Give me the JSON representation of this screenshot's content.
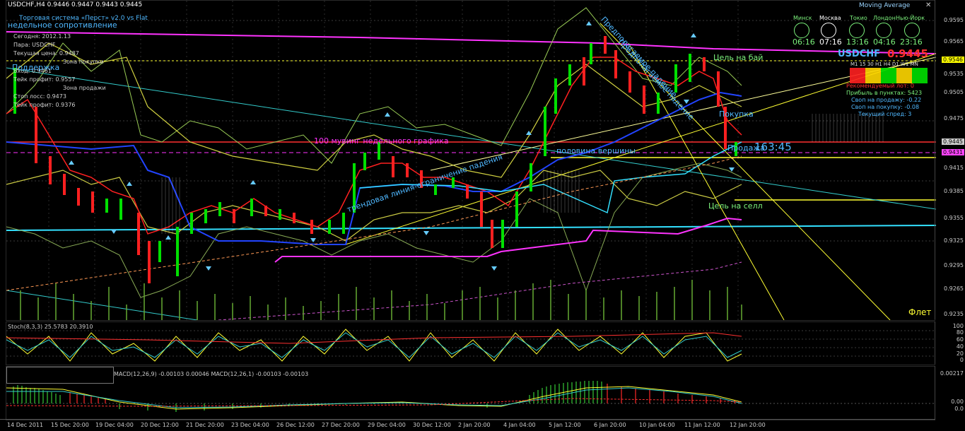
{
  "header": {
    "symbol_line": "USDCHF,H4  0.9446 0.9447 0.9443 0.9445",
    "indicator_name": "Moving Average",
    "subtitle": "Торговая система «Перст» v2.0 vs Flat"
  },
  "clocks": [
    {
      "city": "Минск",
      "time": "06:16"
    },
    {
      "city": "Москва",
      "time": "07:16"
    },
    {
      "city": "Токио",
      "time": "13:16"
    },
    {
      "city": "Лондон",
      "time": "04:16"
    },
    {
      "city": "Нью-Йорк",
      "time": "23:16"
    }
  ],
  "info_left": [
    "Сегодня: 2012.1.13",
    "Пара:  USDCHF",
    "Текущая цена: 0.9487",
    "Зона покупки",
    "Вход:       0.9461",
    "Тейк профит:   0.9557",
    "Зона продажи",
    "Стоп лосс:     0.9473",
    "Тейк профит:   0.9376"
  ],
  "info_right": {
    "pair": "USDCHF",
    "price": "0.9445",
    "timeframes": "M1  15  30  H1  H4  D1  W1 MN",
    "lines": [
      "Рекомендуемый лот: 0",
      "Прибыль в пунктах: 5423",
      "Своп на продажу: -0.22",
      "Своп на покупку: -0.08",
      "Текущий спред: 3"
    ]
  },
  "annotations": {
    "resistance_weekly": "недельное сопротивление",
    "support": "Поддержка",
    "ma100": "100 мувинг недельного графика",
    "top_half": "половина вершины",
    "trend_line": "трендовая линия-ограничение падения",
    "expected_fall_1": "Предполагаемое падение",
    "expected_fall_2": "Предполагаемое падение",
    "target_buy": "Цель на бай",
    "target_sell": "Цель на селл",
    "buy": "Покупка",
    "sell": "Продажа",
    "timer": "163:45",
    "flat": "Флет"
  },
  "price_axis": {
    "ticks": [
      "0.9595",
      "0.9565",
      "0.9535",
      "0.9505",
      "0.9475",
      "0.9445",
      "0.9415",
      "0.9385",
      "0.9355",
      "0.9325",
      "0.9295",
      "0.9265",
      "0.9235"
    ],
    "tags": [
      {
        "value": "0.9546",
        "color": "#ffff00",
        "text_color": "#000"
      },
      {
        "value": "0.9445",
        "color": "#cccccc",
        "text_color": "#000"
      },
      {
        "value": "0.9431",
        "color": "#ff44ff",
        "text_color": "#000"
      }
    ]
  },
  "stoch": {
    "label": "Stoch(8,3,3) 25.5783 20.3910",
    "ticks": [
      "100",
      "80",
      "60",
      "40",
      "20",
      "0"
    ]
  },
  "macd": {
    "label": "MACD(12,26,9) -0.00103 0.00046  MACD(12,26,1) -0.00103 -0.00103",
    "ticks": [
      "0.00217",
      "0.00",
      "0.0"
    ]
  },
  "dates": [
    "14 Dec 2011",
    "15 Dec 20:00",
    "19 Dec 04:00",
    "20 Dec 12:00",
    "21 Dec 20:00",
    "23 Dec 04:00",
    "26 Dec 12:00",
    "27 Dec 20:00",
    "29 Dec 04:00",
    "30 Dec 12:00",
    "2 Jan 20:00",
    "4 Jan 04:00",
    "5 Jan 12:00",
    "6 Jan 20:00",
    "10 Jan 04:00",
    "11 Jan 12:00",
    "12 Jan 20:00"
  ],
  "colors": {
    "bull": "#00e000",
    "bear": "#ff2020",
    "magenta": "#ff33ff",
    "cyan": "#33e0ff",
    "yellow": "#ffff33"
  }
}
